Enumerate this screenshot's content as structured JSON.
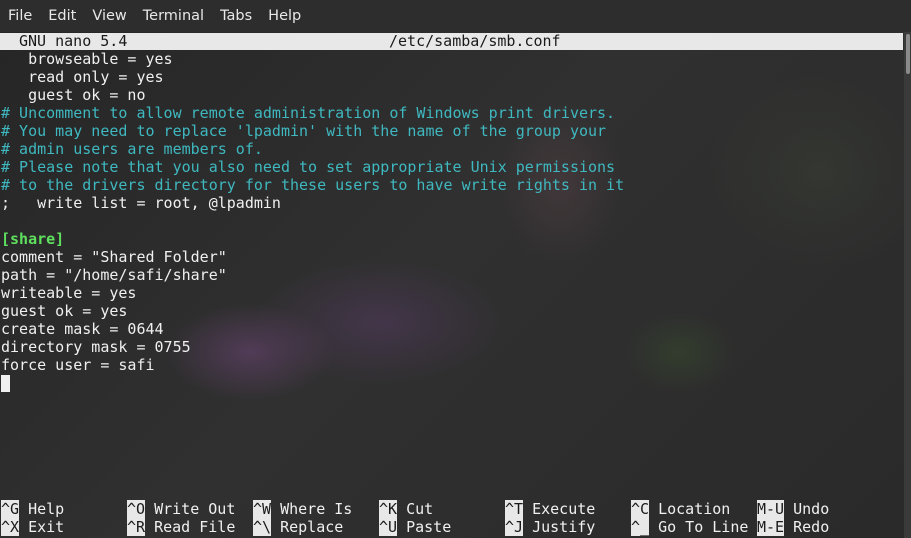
{
  "menu": [
    "File",
    "Edit",
    "View",
    "Terminal",
    "Tabs",
    "Help"
  ],
  "nano": {
    "app": "GNU nano 5.4",
    "file": "/etc/samba/smb.conf"
  },
  "lines": [
    {
      "text": "   browseable = yes",
      "kind": "normal"
    },
    {
      "text": "   read only = yes",
      "kind": "normal"
    },
    {
      "text": "   guest ok = no",
      "kind": "normal"
    },
    {
      "text": "# Uncomment to allow remote administration of Windows print drivers.",
      "kind": "comment"
    },
    {
      "text": "# You may need to replace 'lpadmin' with the name of the group your",
      "kind": "comment"
    },
    {
      "text": "# admin users are members of.",
      "kind": "comment"
    },
    {
      "text": "# Please note that you also need to set appropriate Unix permissions",
      "kind": "comment"
    },
    {
      "text": "# to the drivers directory for these users to have write rights in it",
      "kind": "comment"
    },
    {
      "text": ";   write list = root, @lpadmin",
      "kind": "normal"
    },
    {
      "text": "",
      "kind": "normal"
    },
    {
      "text": "[share]",
      "kind": "section"
    },
    {
      "text": "comment = \"Shared Folder\"",
      "kind": "normal"
    },
    {
      "text": "path = \"/home/safi/share\"",
      "kind": "normal"
    },
    {
      "text": "writeable = yes",
      "kind": "normal"
    },
    {
      "text": "guest ok = yes",
      "kind": "normal"
    },
    {
      "text": "create mask = 0644",
      "kind": "normal"
    },
    {
      "text": "directory mask = 0755",
      "kind": "normal"
    },
    {
      "text": "force user = safi",
      "kind": "normal"
    }
  ],
  "shortcuts": [
    {
      "key": "^G",
      "label": "Help"
    },
    {
      "key": "^O",
      "label": "Write Out"
    },
    {
      "key": "^W",
      "label": "Where Is"
    },
    {
      "key": "^K",
      "label": "Cut"
    },
    {
      "key": "^T",
      "label": "Execute"
    },
    {
      "key": "^C",
      "label": "Location"
    },
    {
      "key": "M-U",
      "label": "Undo"
    },
    {
      "key": "^X",
      "label": "Exit"
    },
    {
      "key": "^R",
      "label": "Read File"
    },
    {
      "key": "^\\",
      "label": "Replace"
    },
    {
      "key": "^U",
      "label": "Paste"
    },
    {
      "key": "^J",
      "label": "Justify"
    },
    {
      "key": "^_",
      "label": "Go To Line"
    },
    {
      "key": "M-E",
      "label": "Redo"
    }
  ]
}
